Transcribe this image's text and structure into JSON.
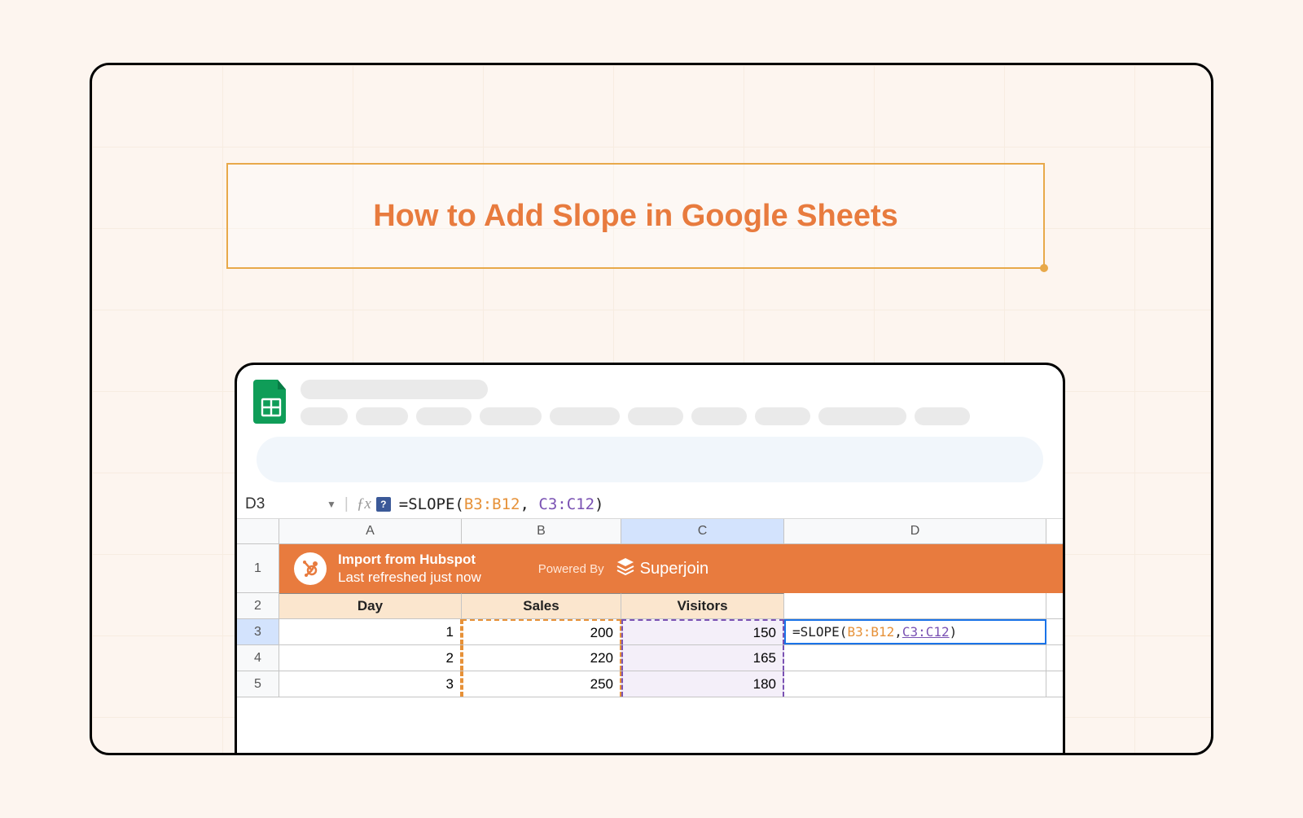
{
  "title": "How to Add Slope in Google Sheets",
  "formula_bar": {
    "cell_ref": "D3",
    "prefix": "=SLOPE(",
    "range1": "B3:B12",
    "sep": ", ",
    "range2a": "C3:C",
    "range2b": "12",
    "suffix": ")"
  },
  "columns": [
    "A",
    "B",
    "C",
    "D"
  ],
  "banner": {
    "title": "Import from Hubspot",
    "subtitle": "Last refreshed just now",
    "powered_by": "Powered By",
    "brand": "Superjoin"
  },
  "headers": {
    "a": "Day",
    "b": "Sales",
    "c": "Visitors"
  },
  "rows": [
    {
      "num": "1"
    },
    {
      "num": "2"
    },
    {
      "num": "3",
      "a": "1",
      "b": "200",
      "c": "150"
    },
    {
      "num": "4",
      "a": "2",
      "b": "220",
      "c": "165"
    },
    {
      "num": "5",
      "a": "3",
      "b": "250",
      "c": "180"
    }
  ],
  "active_formula": {
    "prefix": "=SLOPE(",
    "range1": "B3:B12",
    "sep": ", ",
    "range2": "C3:C12",
    "suffix": ")"
  }
}
